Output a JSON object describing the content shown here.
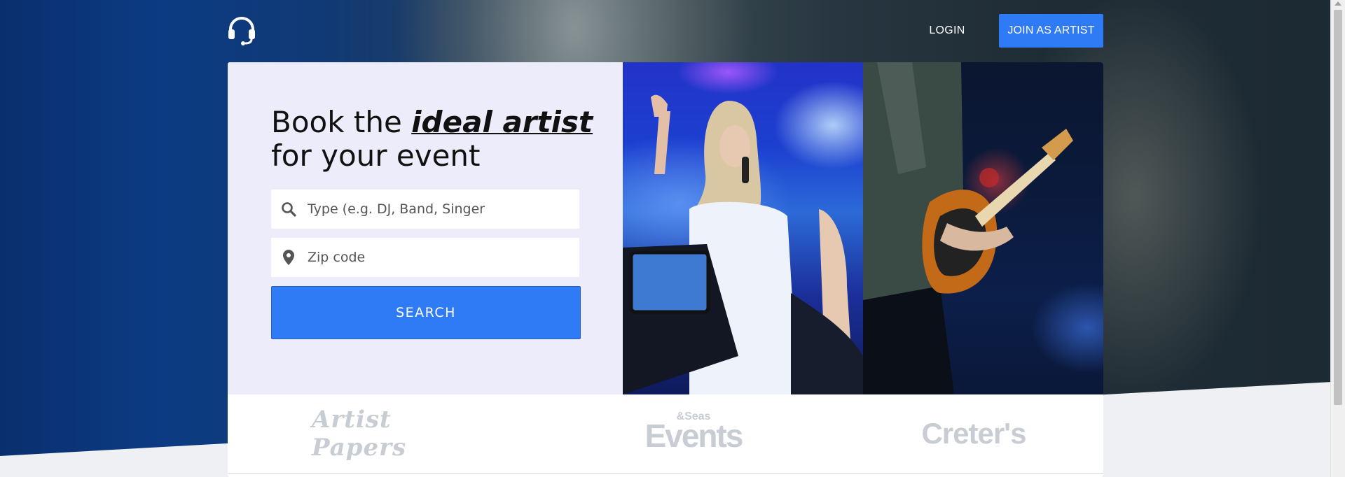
{
  "nav": {
    "logo_icon": "headset-icon",
    "login_label": "LOGIN",
    "join_label": "JOIN AS ARTIST",
    "accent_color": "#2f7bf5"
  },
  "hero": {
    "headline_prefix": "Book the ",
    "headline_emphasis": "ideal artist",
    "headline_suffix": "for your event",
    "type_placeholder": "Type (e.g. DJ, Band, Singer",
    "zip_placeholder": "Zip code",
    "search_label": "SEARCH",
    "type_icon": "search-icon",
    "zip_icon": "location-pin-icon"
  },
  "partners": [
    {
      "name": "Artist Papers"
    },
    {
      "sup": "&Seas",
      "name": "Events"
    },
    {
      "name": "Creter's"
    }
  ]
}
